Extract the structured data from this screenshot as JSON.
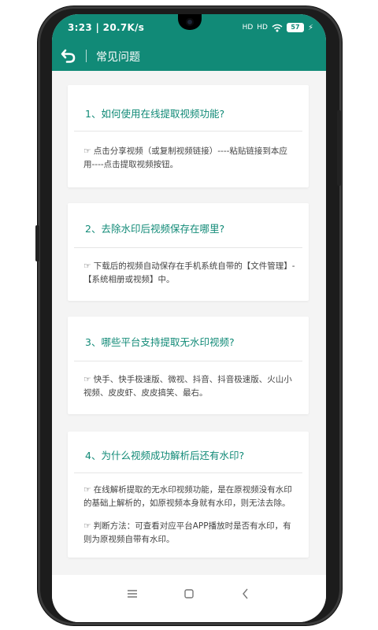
{
  "status": {
    "time": "3:23 | 20.7K/s",
    "signal1": "HD",
    "signal2": "HD",
    "battery": "57"
  },
  "appbar": {
    "back_icon": "back-arrow-icon",
    "title": "常见问题"
  },
  "faq": [
    {
      "question": "1、如何使用在线提取视频功能?",
      "answers": [
        "☞ 点击分享视频（或复制视频链接）----粘贴链接到本应用----点击提取视频按钮。"
      ]
    },
    {
      "question": "2、去除水印后视频保存在哪里?",
      "answers": [
        "☞ 下载后的视频自动保存在手机系统自带的【文件管理】-【系统相册或视频】中。"
      ]
    },
    {
      "question": "3、哪些平台支持提取无水印视频?",
      "answers": [
        "☞ 快手、快手极速版、微视、抖音、抖音极速版、火山小视频、皮皮虾、皮皮搞笑、最右。"
      ]
    },
    {
      "question": "4、为什么视频成功解析后还有水印?",
      "answers": [
        "☞ 在线解析提取的无水印视频功能，是在原视频没有水印的基础上解析的，如原视频本身就有水印，则无法去除。",
        "☞ 判断方法：可查看对应平台APP播放时是否有水印，有则为原视频自带有水印。"
      ]
    }
  ],
  "navbar": {
    "menu_icon": "menu-icon",
    "home_icon": "home-square-icon",
    "back_icon": "back-chevron-icon"
  },
  "colors": {
    "accent": "#118a77",
    "background": "#f4f4f4"
  }
}
